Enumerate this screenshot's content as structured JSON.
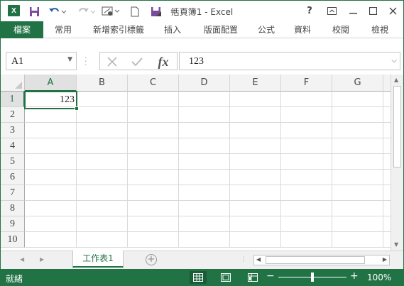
{
  "app": {
    "title": "活頁簿1 - Excel",
    "logo_letter": "X",
    "accent_color": "#217346"
  },
  "title_controls": {
    "help": "?"
  },
  "ribbon": {
    "tabs": [
      "檔案",
      "常用",
      "新增索引標籤",
      "插入",
      "版面配置",
      "公式",
      "資料",
      "校閱",
      "檢視"
    ]
  },
  "formula_bar": {
    "name_box": "A1",
    "fx_label": "fx",
    "content": "123"
  },
  "grid": {
    "columns": [
      "A",
      "B",
      "C",
      "D",
      "E",
      "F",
      "G"
    ],
    "rows": [
      "1",
      "2",
      "3",
      "4",
      "5",
      "6",
      "7",
      "8",
      "9",
      "10"
    ],
    "selected_cell": "A1",
    "cells": {
      "A1": "123"
    }
  },
  "sheets": {
    "tabs": [
      "工作表1"
    ],
    "active": "工作表1"
  },
  "status": {
    "text": "就緒",
    "zoom": "100%",
    "zoom_minus": "−",
    "zoom_plus": "+"
  },
  "icons": [
    "excel-logo-icon",
    "save-icon",
    "undo-icon",
    "redo-icon",
    "touch-mode-icon",
    "new-file-icon",
    "open-file-icon",
    "customize-toolbar-icon",
    "help-icon",
    "ribbon-display-icon",
    "minimize-icon",
    "maximize-icon",
    "close-icon",
    "cancel-icon",
    "enter-icon",
    "normal-view-icon",
    "page-layout-view-icon",
    "page-break-view-icon"
  ]
}
